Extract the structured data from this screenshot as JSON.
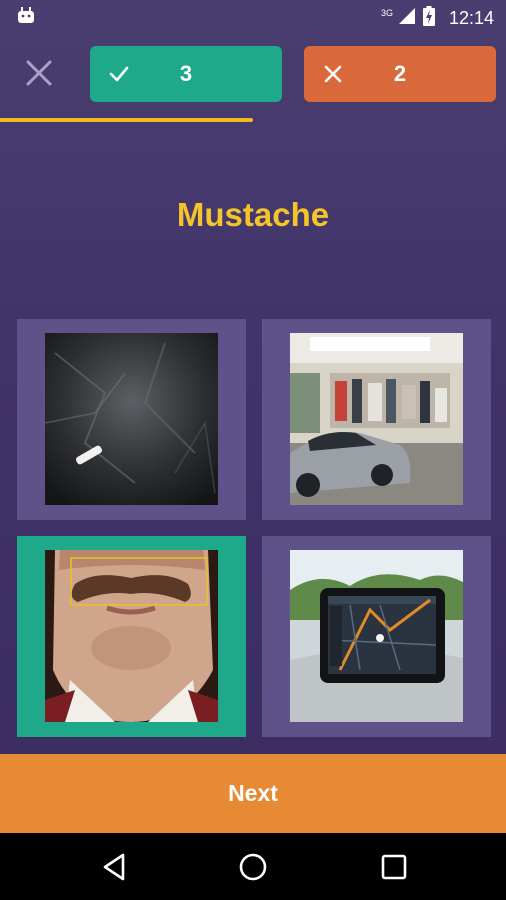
{
  "status_bar": {
    "network": "3G",
    "time": "12:14",
    "icons": [
      "android-icon",
      "signal-icon",
      "battery-icon"
    ]
  },
  "score": {
    "correct_count": "3",
    "wrong_count": "2",
    "correct_color": "#1ea98a",
    "wrong_color": "#d9693a"
  },
  "progress": {
    "fraction": 0.5
  },
  "challenge": {
    "word": "Mustache"
  },
  "tiles": [
    {
      "subject": "black plastic bag with white chalk",
      "selected": false
    },
    {
      "subject": "garage with silver sports car",
      "selected": false
    },
    {
      "subject": "man with mustache",
      "selected": true
    },
    {
      "subject": "car navigation screen",
      "selected": false
    }
  ],
  "actions": {
    "next_label": "Next"
  },
  "nav": {
    "icons": [
      "back-icon",
      "home-icon",
      "recents-icon"
    ]
  },
  "colors": {
    "accent_yellow": "#f4c52a",
    "next_orange": "#e88a33",
    "tile_bg": "#5f5189"
  }
}
